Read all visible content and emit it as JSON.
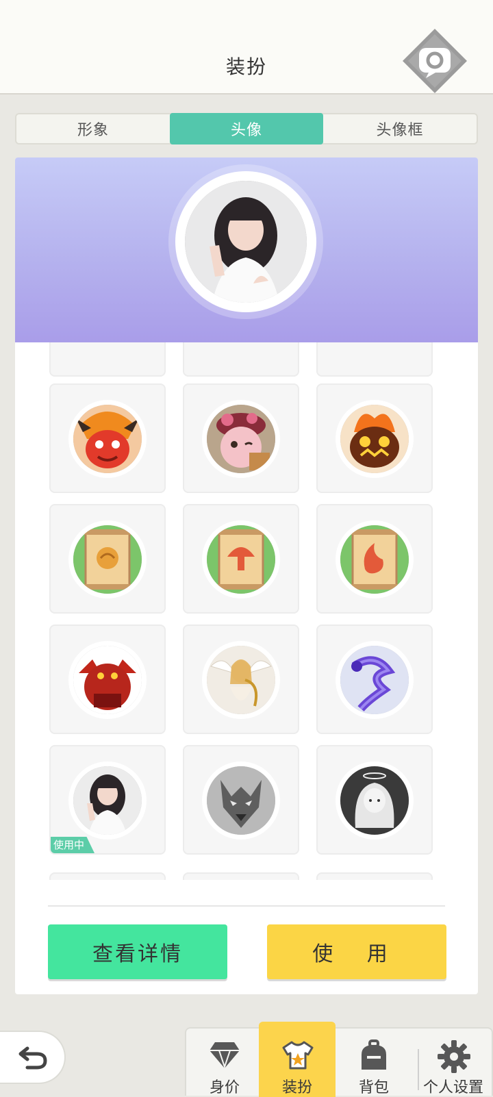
{
  "header": {
    "title": "装扮",
    "corner_icon": "chat-bubble-icon"
  },
  "tabs": [
    {
      "label": "形象",
      "active": false
    },
    {
      "label": "头像",
      "active": true
    },
    {
      "label": "头像框",
      "active": false
    }
  ],
  "preview": {
    "avatar": "girl-waving-avatar"
  },
  "grid": {
    "rows": [
      [
        "fire-bull-demon-avatar",
        "flower-girl-avatar",
        "flame-monster-avatar"
      ],
      [
        "scroll-fist-avatar",
        "scroll-mushroom-avatar",
        "scroll-flame-avatar"
      ],
      [
        "red-demon-warrior-avatar",
        "harp-angel-avatar",
        "purple-dragon-avatar"
      ],
      [
        "girl-waving-avatar",
        "wolf-avatar",
        "angel-girl-avatar"
      ]
    ],
    "using_badge": "使用中"
  },
  "buttons": {
    "detail": "查看详情",
    "use": "使 用"
  },
  "bottom_nav": [
    {
      "label": "身价",
      "icon": "diamond-icon"
    },
    {
      "label": "装扮",
      "icon": "shirt-icon",
      "active": true
    },
    {
      "label": "背包",
      "icon": "backpack-icon"
    },
    {
      "label": "个人设置",
      "icon": "gear-icon"
    }
  ],
  "colors": {
    "accent_teal": "#53c7ac",
    "detail_green": "#44e59e",
    "use_yellow": "#fbd545",
    "banner_purple": "#b5b2ee"
  }
}
